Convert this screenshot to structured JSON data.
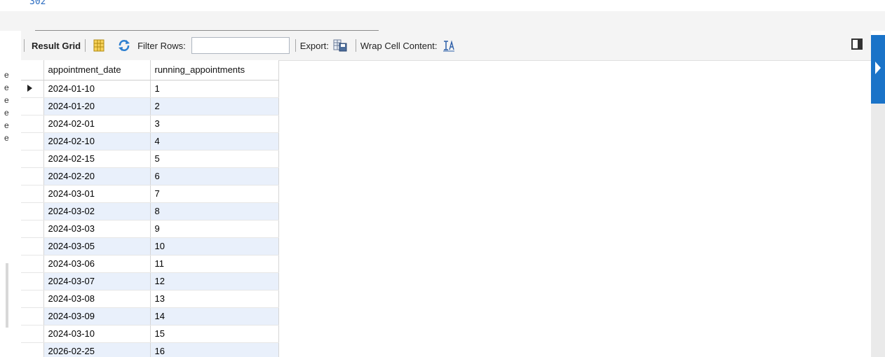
{
  "editor": {
    "line_number": "302"
  },
  "toolbar": {
    "result_grid_label": "Result Grid",
    "filter_rows_label": "Filter Rows:",
    "filter_value": "",
    "export_label": "Export:",
    "wrap_label": "Wrap Cell Content:"
  },
  "grid": {
    "columns": [
      "appointment_date",
      "running_appointments"
    ],
    "rows": [
      [
        "2024-01-10",
        "1"
      ],
      [
        "2024-01-20",
        "2"
      ],
      [
        "2024-02-01",
        "3"
      ],
      [
        "2024-02-10",
        "4"
      ],
      [
        "2024-02-15",
        "5"
      ],
      [
        "2024-02-20",
        "6"
      ],
      [
        "2024-03-01",
        "7"
      ],
      [
        "2024-03-02",
        "8"
      ],
      [
        "2024-03-03",
        "9"
      ],
      [
        "2024-03-05",
        "10"
      ],
      [
        "2024-03-06",
        "11"
      ],
      [
        "2024-03-07",
        "12"
      ],
      [
        "2024-03-08",
        "13"
      ],
      [
        "2024-03-09",
        "14"
      ],
      [
        "2024-03-10",
        "15"
      ],
      [
        "2026-02-25",
        "16"
      ]
    ],
    "selected_row": 0
  },
  "left_fragment": [
    "e",
    "e",
    "e",
    "e",
    "e",
    "e"
  ],
  "colors": {
    "accent": "#1a73c8",
    "row_stripe": "#e9f0fb"
  },
  "icons": {
    "form_editor": "grid-columns-icon",
    "refresh": "refresh-icon",
    "export": "export-icon",
    "wrap": "wrap-text-icon",
    "panel": "panel-toggle-icon"
  }
}
